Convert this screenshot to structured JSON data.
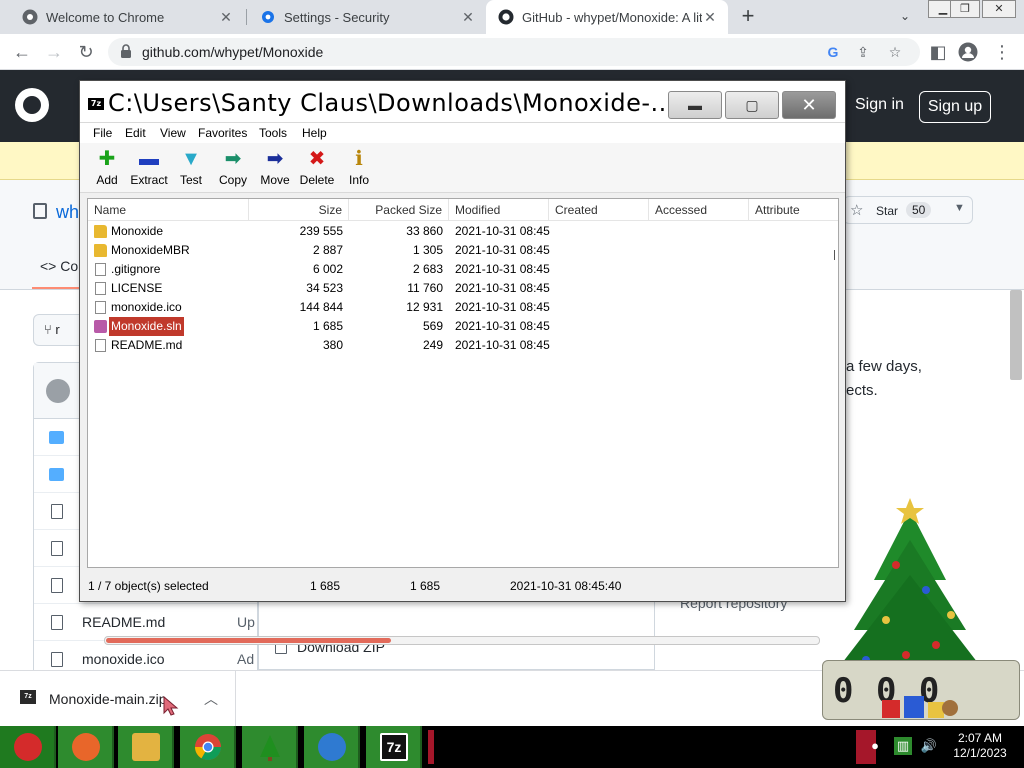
{
  "browser": {
    "tabs": [
      {
        "title": "Welcome to Chrome",
        "active": false
      },
      {
        "title": "Settings - Security",
        "active": false
      },
      {
        "title": "GitHub - whypet/Monoxide: A lit",
        "active": true
      }
    ],
    "url": "github.com/whypet/Monoxide"
  },
  "github": {
    "signin": "Sign in",
    "signup": "Sign up",
    "repo_name_partial": "wh",
    "code_tab": "Co",
    "branch_partial": "r",
    "star_label": "Star",
    "star_count": "50",
    "about_line1": "a few days,",
    "about_line2": "ects.",
    "report": "Report repository",
    "download_zip": "Download ZIP",
    "files": [
      {
        "type": "folder",
        "name": "",
        "msg": ""
      },
      {
        "type": "folder",
        "name": "",
        "msg": ""
      },
      {
        "type": "file",
        "name": "",
        "msg": ""
      },
      {
        "type": "file",
        "name": "",
        "msg": ""
      },
      {
        "type": "file",
        "name": "",
        "msg": ""
      },
      {
        "type": "file",
        "name": "README.md",
        "msg": "Up"
      },
      {
        "type": "file",
        "name": "monoxide.ico",
        "msg": "Ad"
      }
    ]
  },
  "sevenzip": {
    "title": "C:\\Users\\Santy Claus\\Downloads\\Monoxide-...",
    "app_icon": "7z",
    "menu": [
      "File",
      "Edit",
      "View",
      "Favorites",
      "Tools",
      "Help"
    ],
    "toolbar": [
      {
        "label": "Add",
        "icon": "plus-icon",
        "glyph": "✚",
        "color": "#1aa31a"
      },
      {
        "label": "Extract",
        "icon": "minus-icon",
        "glyph": "▬",
        "color": "#1f3fbf"
      },
      {
        "label": "Test",
        "icon": "check-icon",
        "glyph": "▼",
        "color": "#29a9c9"
      },
      {
        "label": "Copy",
        "icon": "copy-arrow-icon",
        "glyph": "➡",
        "color": "#1b8f6a"
      },
      {
        "label": "Move",
        "icon": "move-arrow-icon",
        "glyph": "➡",
        "color": "#1b2f9a"
      },
      {
        "label": "Delete",
        "icon": "delete-x-icon",
        "glyph": "✖",
        "color": "#d41818"
      },
      {
        "label": "Info",
        "icon": "info-icon",
        "glyph": "ℹ",
        "color": "#b8860b"
      }
    ],
    "columns": [
      "Name",
      "Size",
      "Packed Size",
      "Modified",
      "Created",
      "Accessed",
      "Attribute"
    ],
    "rows": [
      {
        "name": "Monoxide",
        "type": "folder",
        "size": "239 555",
        "packed": "33 860",
        "modified": "2021-10-31 08:45"
      },
      {
        "name": "MonoxideMBR",
        "type": "folder",
        "size": "2 887",
        "packed": "1 305",
        "modified": "2021-10-31 08:45"
      },
      {
        "name": ".gitignore",
        "type": "file",
        "size": "6 002",
        "packed": "2 683",
        "modified": "2021-10-31 08:45"
      },
      {
        "name": "LICENSE",
        "type": "file",
        "size": "34 523",
        "packed": "11 760",
        "modified": "2021-10-31 08:45"
      },
      {
        "name": "monoxide.ico",
        "type": "file",
        "size": "144 844",
        "packed": "12 931",
        "modified": "2021-10-31 08:45"
      },
      {
        "name": "Monoxide.sln",
        "type": "sln",
        "size": "1 685",
        "packed": "569",
        "modified": "2021-10-31 08:45",
        "selected": true
      },
      {
        "name": "README.md",
        "type": "file",
        "size": "380",
        "packed": "249",
        "modified": "2021-10-31 08:45"
      }
    ],
    "scroll_fraction": 0.4,
    "status": {
      "selection": "1 / 7 object(s) selected",
      "size": "1 685",
      "packed": "1 685",
      "modified": "2021-10-31 08:45:40"
    }
  },
  "downloads": {
    "file": "Monoxide-main.zip",
    "icon": "7z"
  },
  "clock_gadget": {
    "digits": "0 0 0"
  },
  "taskbar": {
    "apps": [
      {
        "name": "santa-start",
        "icon": "santa-icon",
        "color": "#d42b2b"
      },
      {
        "name": "firefox",
        "icon": "firefox-icon",
        "color": "#e8662a"
      },
      {
        "name": "file-explorer",
        "icon": "folder-icon",
        "color": "#e3b341"
      },
      {
        "name": "chrome",
        "icon": "chrome-icon",
        "color": "#db4437"
      },
      {
        "name": "tree",
        "icon": "tree-icon",
        "color": "#1f8f1f"
      },
      {
        "name": "thunderbird",
        "icon": "thunderbird-icon",
        "color": "#2f7ad1"
      },
      {
        "name": "7zip",
        "icon": "7zip-icon",
        "color": "#111111",
        "text": "7z"
      }
    ],
    "time": "2:07 AM",
    "date": "12/1/2023"
  }
}
